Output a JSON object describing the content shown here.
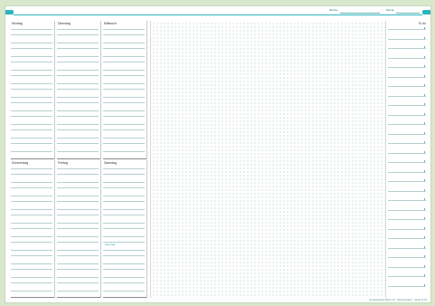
{
  "header": {
    "field1_label": "Woche",
    "field2_label": "Monat"
  },
  "days": {
    "montag": "Montag",
    "dienstag": "Dienstag",
    "mittwoch": "Mittwoch",
    "donnerstag": "Donnerstag",
    "freitag": "Freitag",
    "samstag": "Samstag",
    "sonntag": "Sonntag"
  },
  "todo": {
    "title": "To do"
  },
  "footer": {
    "text": "(c) Designwerk Berlin 3.0 · Wochenplaner · Stand 11.19"
  },
  "colors": {
    "accent": "#2bb4be",
    "background": "#d9e7cc",
    "paper": "#ffffff",
    "rule": "#b6cfd1"
  }
}
